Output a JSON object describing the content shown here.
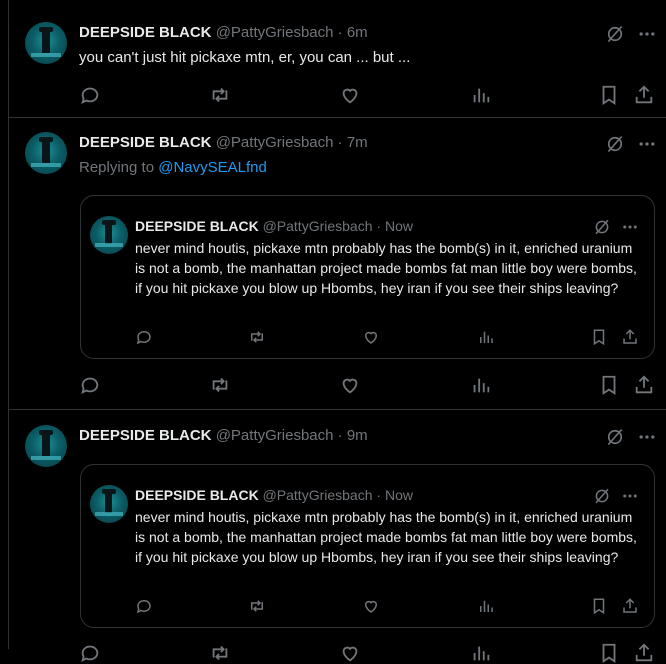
{
  "posts": [
    {
      "author": "DEEPSIDE BLACK",
      "handle": "@PattyGriesbach",
      "dot": "·",
      "time": "6m",
      "text": "you can't just hit pickaxe mtn, er, you can ... but ..."
    },
    {
      "author": "DEEPSIDE BLACK",
      "handle": "@PattyGriesbach",
      "dot": "·",
      "time": "7m",
      "replying_prefix": "Replying to ",
      "replying_to": "@NavySEALfnd",
      "quote": {
        "author": "DEEPSIDE BLACK",
        "handle": "@PattyGriesbach",
        "dot": "·",
        "time": "Now",
        "text": "never mind houtis, pickaxe mtn probably has the bomb(s) in it, enriched uranium is not a bomb, the manhattan project made bombs fat man little boy were bombs, if you hit pickaxe you blow up Hbombs, hey iran if you see their ships leaving?"
      }
    },
    {
      "author": "DEEPSIDE BLACK",
      "handle": "@PattyGriesbach",
      "dot": "·",
      "time": "9m",
      "quote": {
        "author": "DEEPSIDE BLACK",
        "handle": "@PattyGriesbach",
        "dot": "·",
        "time": "Now",
        "text": "never mind houtis, pickaxe mtn probably has the bomb(s) in it, enriched uranium is not a bomb, the manhattan project made bombs fat man little boy were bombs, if you hit pickaxe you blow up Hbombs, hey iran if you see their ships leaving?"
      }
    }
  ],
  "icons": {
    "reply": "reply-icon",
    "repost": "repost-icon",
    "like": "like-icon",
    "views": "views-icon",
    "bookmark": "bookmark-icon",
    "share": "share-icon",
    "grok": "grok-icon",
    "more": "more-icon"
  },
  "colors": {
    "background": "#000000",
    "text": "#e7e9ea",
    "muted": "#71767b",
    "link": "#1d9bf0",
    "border": "#2f3336"
  }
}
